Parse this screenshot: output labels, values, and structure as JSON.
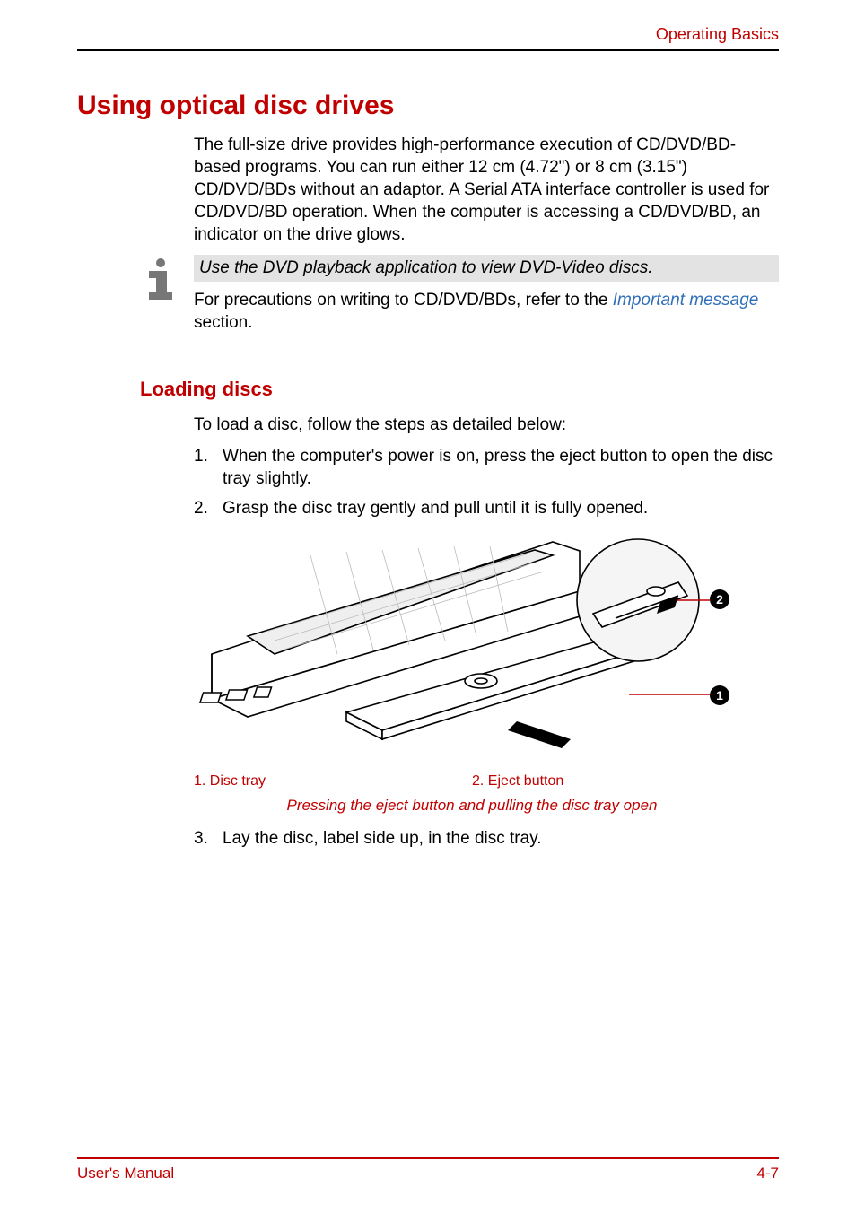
{
  "header": {
    "section_title": "Operating Basics"
  },
  "section": {
    "heading": "Using optical disc drives",
    "intro": "The full-size drive provides high-performance execution of CD/DVD/BD-based programs. You can run either 12 cm (4.72\") or 8 cm (3.15\") CD/DVD/BDs without an adaptor. A Serial ATA interface controller is used for CD/DVD/BD operation. When the computer is accessing a CD/DVD/BD, an indicator on the drive glows.",
    "note": "Use the DVD playback application to view DVD-Video discs.",
    "precaution_prefix": "For precautions on writing to CD/DVD/BDs, refer to the ",
    "precaution_link": "Important message",
    "precaution_suffix": " section.",
    "subheading": "Loading discs",
    "subintro": "To load a disc, follow the steps as detailed below:",
    "steps": {
      "n1": "1.",
      "t1": "When the computer's power is on, press the eject button to open the disc tray slightly.",
      "n2": "2.",
      "t2": "Grasp the disc tray gently and pull until it is fully opened.",
      "n3": "3.",
      "t3": "Lay the disc, label side up, in the disc tray."
    },
    "figure": {
      "callout1": "1",
      "callout2": "2",
      "label1": "1. Disc tray",
      "label2": "2. Eject button",
      "caption": "Pressing the eject button and pulling the disc tray open"
    }
  },
  "footer": {
    "manual": "User's Manual",
    "page": "4-7"
  }
}
